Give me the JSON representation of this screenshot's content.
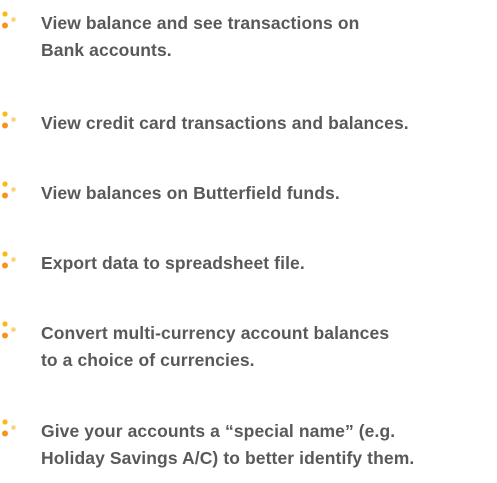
{
  "features": [
    {
      "lines": [
        "View balance and see transactions on",
        "Bank accounts."
      ]
    },
    {
      "lines": [
        "View credit card transactions and balances."
      ]
    },
    {
      "lines": [
        "View balances on Butterfield funds."
      ]
    },
    {
      "lines": [
        "Export data to spreadsheet file."
      ]
    },
    {
      "lines": [
        "Convert multi-currency account balances",
        "to a choice of currencies."
      ]
    },
    {
      "lines": [
        "Give your accounts a “special name” (e.g.",
        "Holiday Savings A/C) to better identify them."
      ]
    }
  ],
  "colors": {
    "text": "#58595b",
    "bullet_orange": "#f7941d",
    "bullet_yellow": "#fdb913",
    "bullet_light": "#fcd27a"
  },
  "icons": {
    "bullet": "orange-dots-bullet-icon"
  }
}
